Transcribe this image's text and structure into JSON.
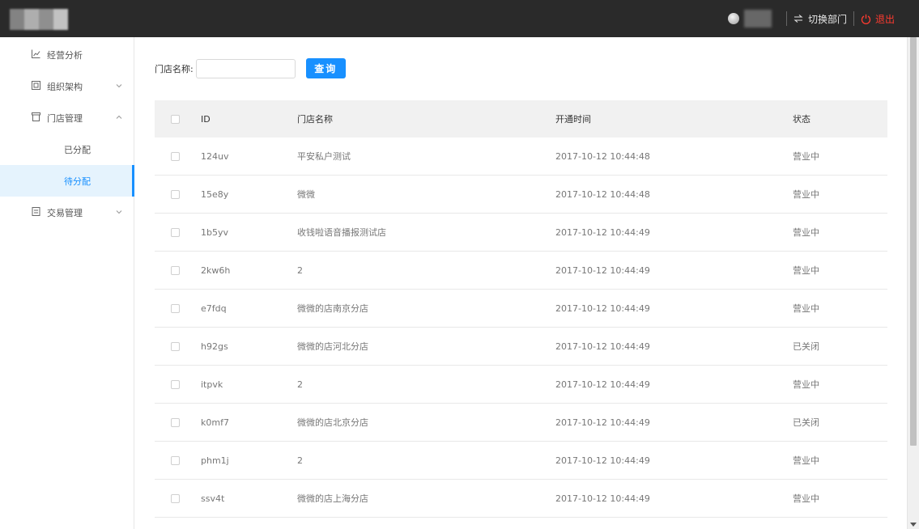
{
  "header": {
    "switch_dept_label": "切换部门",
    "logout_label": "退出"
  },
  "sidebar": {
    "items": [
      {
        "label": "经营分析",
        "icon": "line-chart-icon"
      },
      {
        "label": "组织架构",
        "icon": "org-chart-icon",
        "arrow": "chevron-down"
      },
      {
        "label": "门店管理",
        "icon": "store-icon",
        "arrow": "chevron-up"
      },
      {
        "label": "交易管理",
        "icon": "list-icon",
        "arrow": "chevron-down"
      }
    ],
    "store_sub_items": [
      {
        "label": "已分配"
      },
      {
        "label": "待分配",
        "active": true
      }
    ]
  },
  "search": {
    "label": "门店名称:",
    "value": "",
    "placeholder": "",
    "button_label": "查询"
  },
  "table": {
    "headers": [
      "ID",
      "门店名称",
      "开通时间",
      "状态"
    ],
    "rows": [
      [
        "124uv",
        "平安私户测试",
        "2017-10-12 10:44:48",
        "营业中"
      ],
      [
        "15e8y",
        "微微",
        "2017-10-12 10:44:48",
        "营业中"
      ],
      [
        "1b5yv",
        "收钱啦语音播报测试店",
        "2017-10-12 10:44:49",
        "营业中"
      ],
      [
        "2kw6h",
        "2",
        "2017-10-12 10:44:49",
        "营业中"
      ],
      [
        "e7fdq",
        "微微的店南京分店",
        "2017-10-12 10:44:49",
        "营业中"
      ],
      [
        "h92gs",
        "微微的店河北分店",
        "2017-10-12 10:44:49",
        "已关闭"
      ],
      [
        "itpvk",
        "2",
        "2017-10-12 10:44:49",
        "营业中"
      ],
      [
        "k0mf7",
        "微微的店北京分店",
        "2017-10-12 10:44:49",
        "已关闭"
      ],
      [
        "phm1j",
        "2",
        "2017-10-12 10:44:49",
        "营业中"
      ],
      [
        "ssv4t",
        "微微的店上海分店",
        "2017-10-12 10:44:49",
        "营业中"
      ]
    ]
  },
  "colors": {
    "header_bg": "#2a2a2a",
    "accent": "#1890ff",
    "logout": "#ff3b30",
    "active_menu_bg": "#e5f3fd"
  }
}
